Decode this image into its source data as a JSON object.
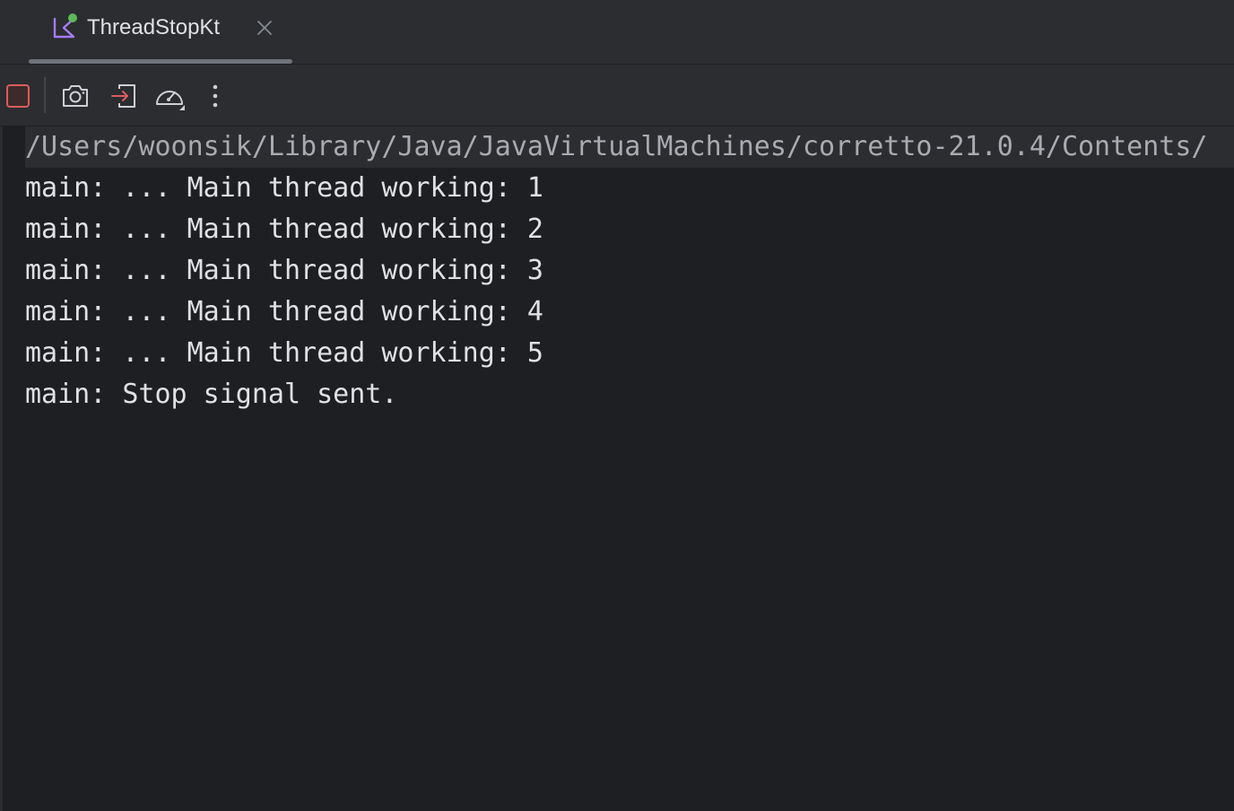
{
  "tab": {
    "title": "ThreadStopKt",
    "icon": "kotlin-run-config-icon",
    "status_color": "#5fb85a",
    "accent_color": "#a77cf8"
  },
  "toolbar": {
    "buttons": [
      {
        "icon": "stop-icon",
        "color": "#db5c5c"
      },
      {
        "icon": "camera-icon"
      },
      {
        "icon": "exit-icon",
        "color": "#db5c5c"
      },
      {
        "icon": "speedometer-icon"
      },
      {
        "icon": "more-vertical-icon"
      }
    ]
  },
  "console": {
    "command_line": "/Users/woonsik/Library/Java/JavaVirtualMachines/corretto-21.0.4/Contents/",
    "lines": [
      "main: ... Main thread working: 1",
      "main: ... Main thread working: 2",
      "main: ... Main thread working: 3",
      "main: ... Main thread working: 4",
      "main: ... Main thread working: 5",
      "main: Stop signal sent."
    ]
  }
}
